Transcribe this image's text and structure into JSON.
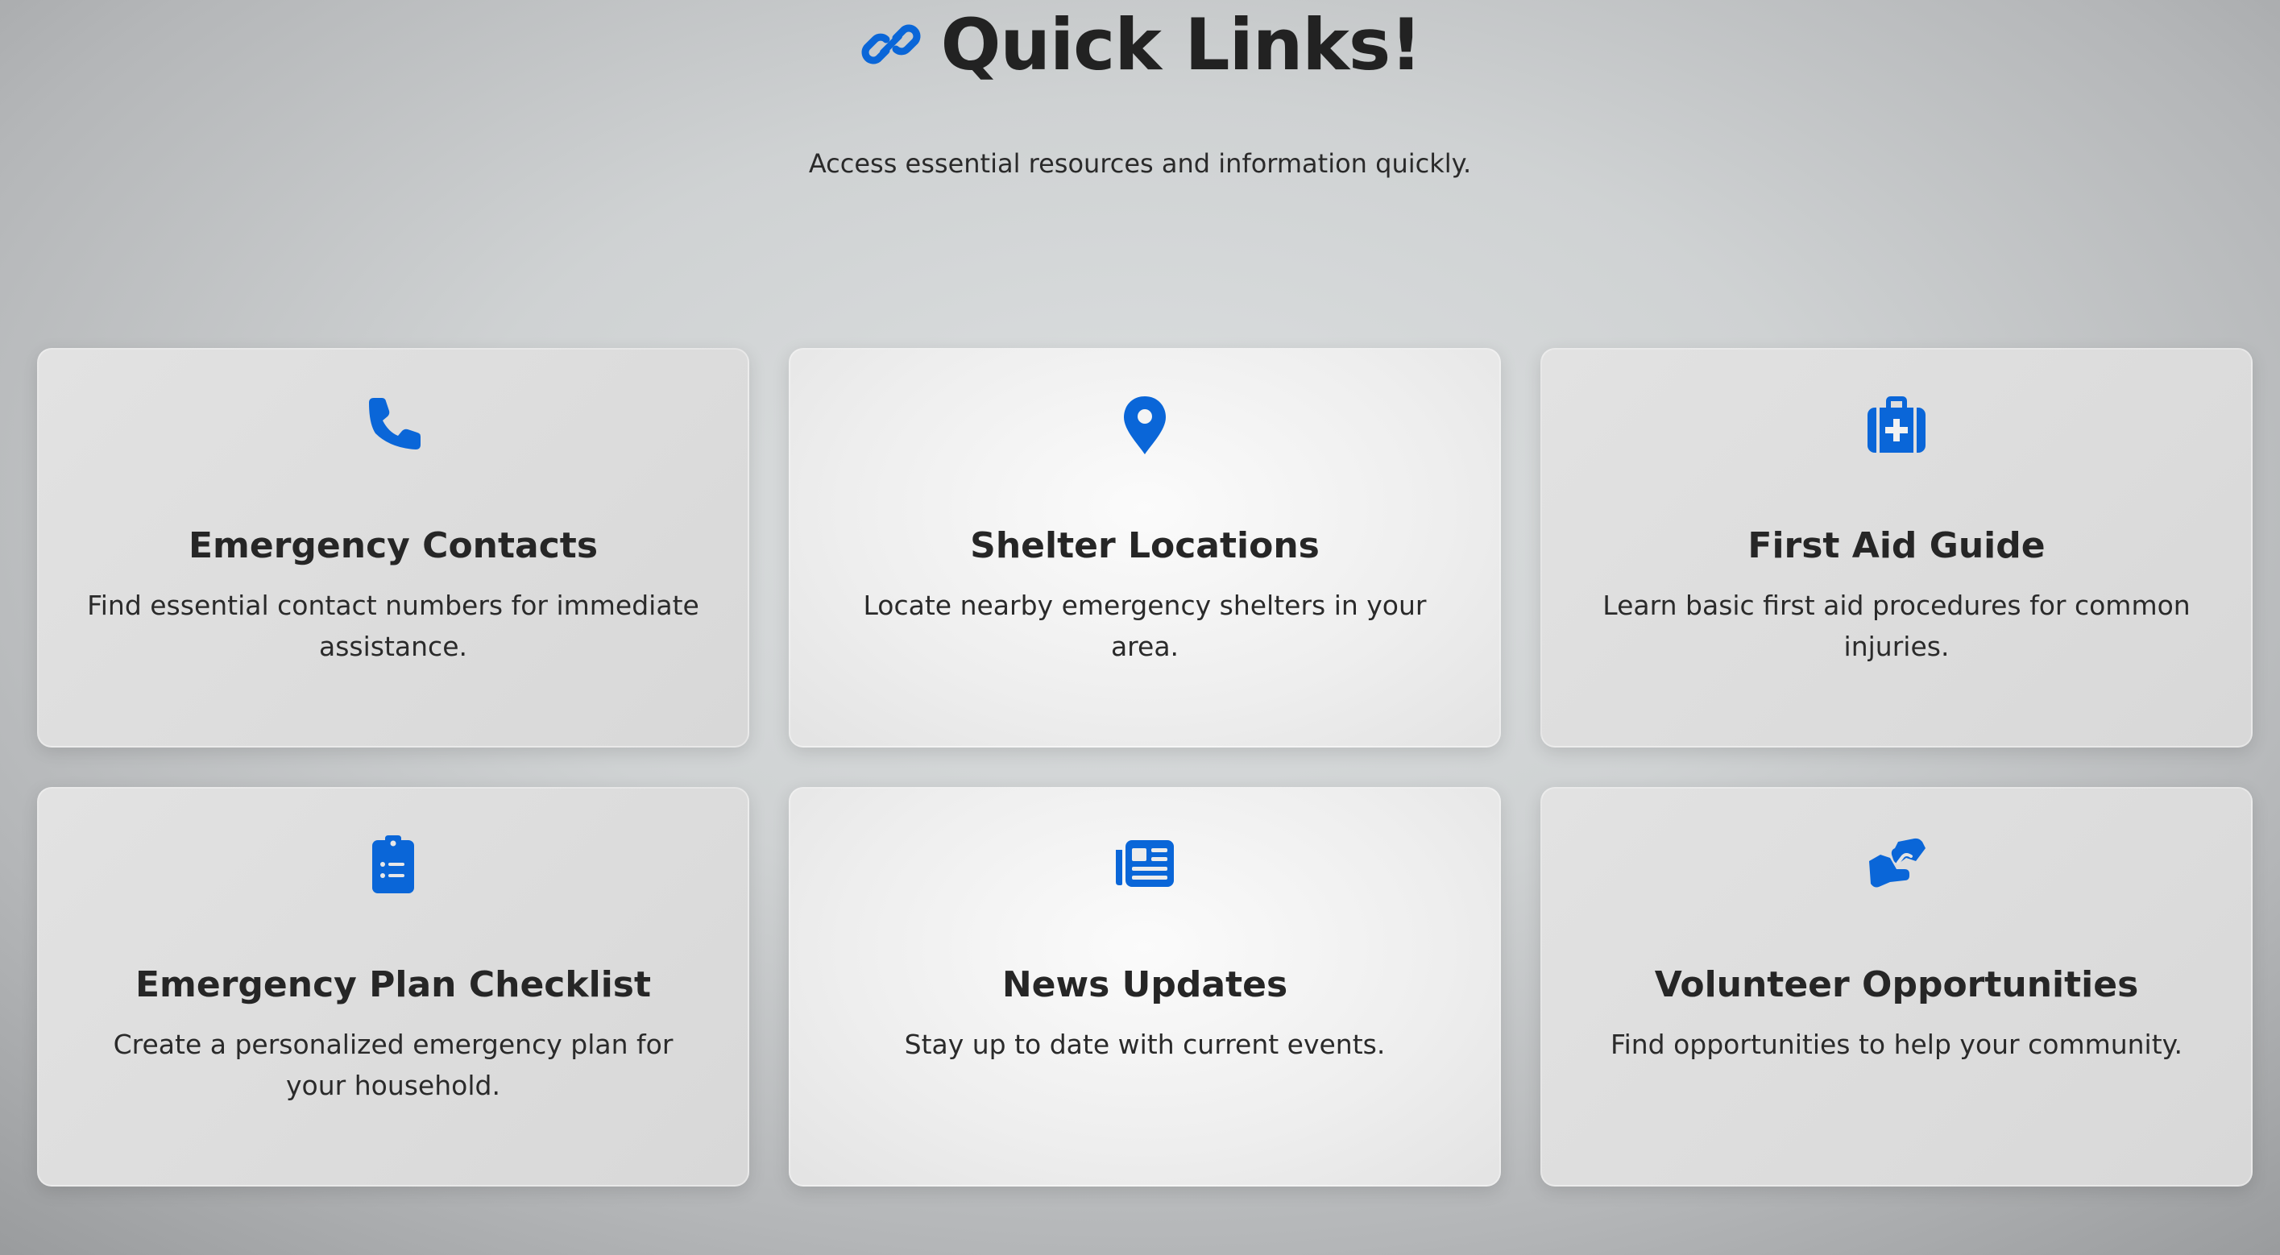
{
  "header": {
    "title": "Quick Links!",
    "title_icon": "link-icon",
    "subtitle": "Access essential resources and information quickly."
  },
  "accent_color": "#0a66d8",
  "cards": [
    {
      "icon": "phone-icon",
      "title": "Emergency Contacts",
      "description": "Find essential contact numbers for immediate assistance."
    },
    {
      "icon": "map-pin-icon",
      "title": "Shelter Locations",
      "description": "Locate nearby emergency shelters in your area."
    },
    {
      "icon": "medkit-icon",
      "title": "First Aid Guide",
      "description": "Learn basic first aid procedures for common injuries."
    },
    {
      "icon": "clipboard-list-icon",
      "title": "Emergency Plan Checklist",
      "description": "Create a personalized emergency plan for your household."
    },
    {
      "icon": "newspaper-icon",
      "title": "News Updates",
      "description": "Stay up to date with current events."
    },
    {
      "icon": "handshake-icon",
      "title": "Volunteer Opportunities",
      "description": "Find opportunities to help your community."
    }
  ]
}
